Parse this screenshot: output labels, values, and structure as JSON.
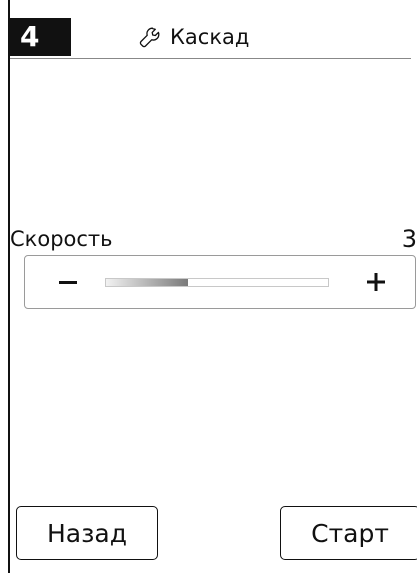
{
  "header": {
    "page_number": "4",
    "title": "Каскад",
    "title_icon": "wrench-icon"
  },
  "speed": {
    "label": "Скорость",
    "value": "3",
    "level_fraction": 0.37,
    "decrease_label": "−",
    "increase_icon": "plus-icon"
  },
  "footer": {
    "back_label": "Назад",
    "start_label": "Старт"
  },
  "colors": {
    "page_number_bg": "#111111",
    "page_number_fg": "#ffffff",
    "border": "#111111"
  }
}
